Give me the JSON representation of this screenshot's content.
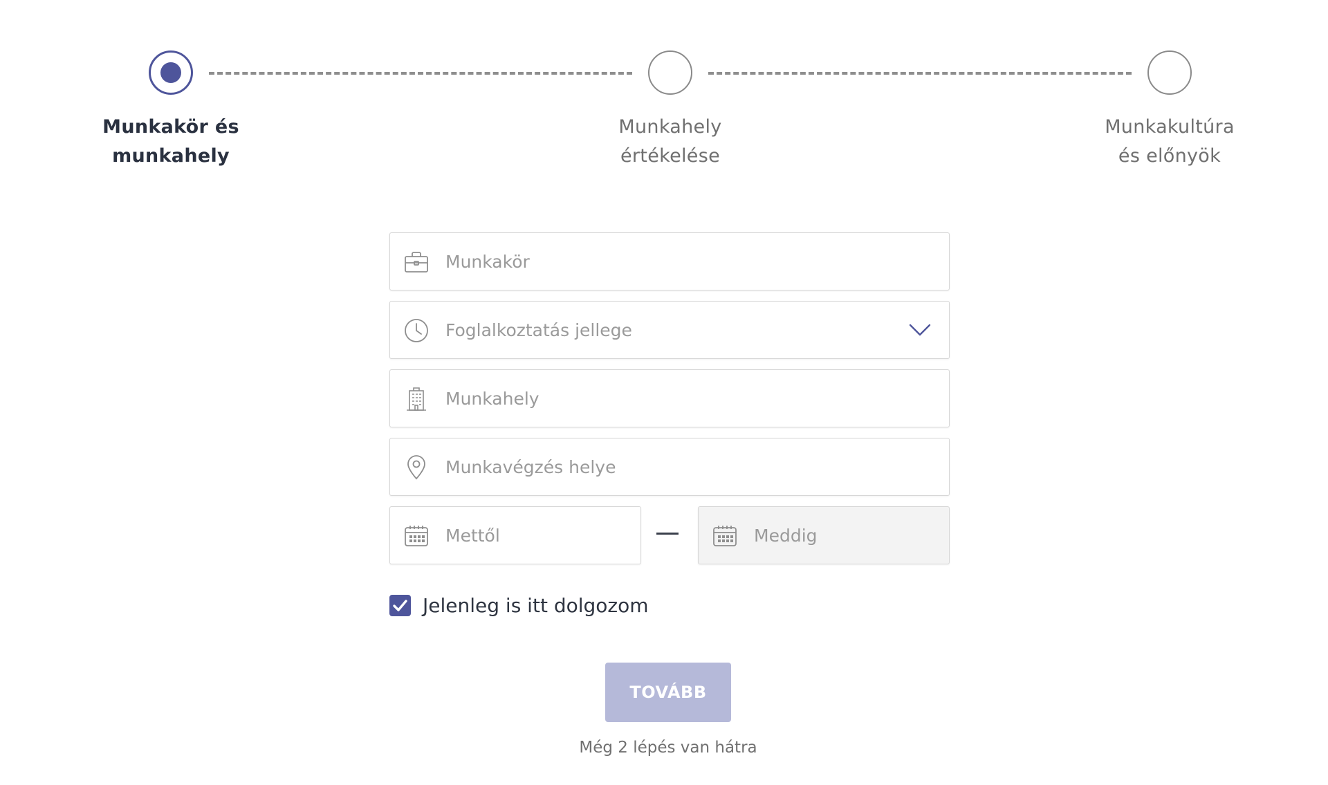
{
  "stepper": {
    "steps": [
      {
        "label_line1": "Munkakör és",
        "label_line2": "munkahely",
        "state": "active"
      },
      {
        "label_line1": "Munkahely",
        "label_line2": "értékelése",
        "state": "inactive"
      },
      {
        "label_line1": "Munkakultúra",
        "label_line2": "és előnyök",
        "state": "inactive"
      }
    ]
  },
  "form": {
    "job_title": {
      "placeholder": "Munkakör",
      "value": "",
      "icon": "briefcase-icon"
    },
    "employment_type": {
      "placeholder": "Foglalkoztatás jellege",
      "value": "",
      "icon": "clock-icon",
      "dropdown_icon": "chevron-down-icon"
    },
    "workplace": {
      "placeholder": "Munkahely",
      "value": "",
      "icon": "building-icon"
    },
    "work_location": {
      "placeholder": "Munkavégzés helye",
      "value": "",
      "icon": "location-pin-icon"
    },
    "date_from": {
      "placeholder": "Mettől",
      "value": "",
      "icon": "calendar-icon"
    },
    "date_to": {
      "placeholder": "Meddig",
      "value": "",
      "icon": "calendar-icon",
      "disabled": true
    },
    "currently_working": {
      "label": "Jelenleg is itt dolgozom",
      "checked": true
    }
  },
  "actions": {
    "next_label": "TOVÁBB",
    "remaining_text": "Még 2 lépés van hátra"
  },
  "colors": {
    "accent": "#4e559b",
    "button_disabled": "#b5b9d9",
    "placeholder": "#9a9a9a",
    "border": "#d6d6d6"
  }
}
